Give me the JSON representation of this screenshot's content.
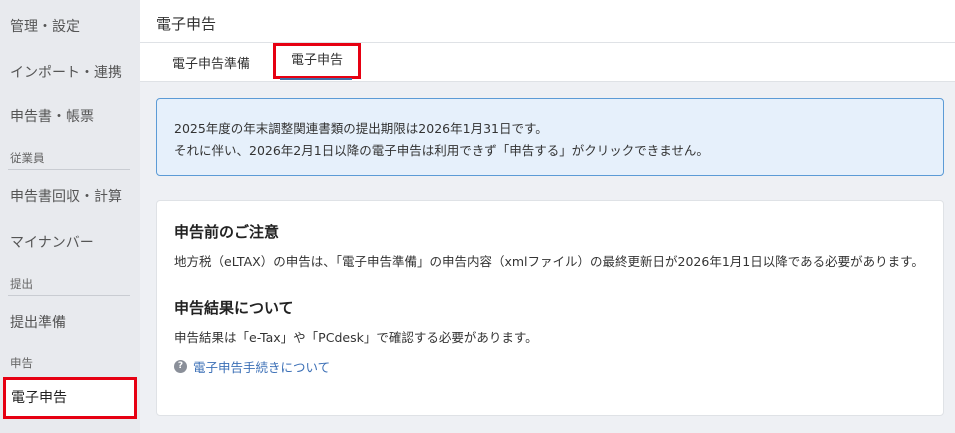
{
  "sidebar": {
    "items": [
      {
        "label": "管理・設定"
      },
      {
        "label": "インポート・連携"
      },
      {
        "label": "申告書・帳票"
      },
      {
        "label": "申告書回収・計算"
      },
      {
        "label": "マイナンバー"
      },
      {
        "label": "提出準備"
      },
      {
        "label": "電子申告"
      }
    ],
    "sections": [
      {
        "label": "従業員"
      },
      {
        "label": "提出"
      },
      {
        "label": "申告"
      }
    ]
  },
  "header": {
    "title": "電子申告"
  },
  "tabs": [
    {
      "label": "電子申告準備"
    },
    {
      "label": "電子申告"
    }
  ],
  "alert": {
    "line1": "2025年度の年末調整関連書類の提出期限は2026年1月31日です。",
    "line2": "それに伴い、2026年2月1日以降の電子申告は利用できず「申告する」がクリックできません。"
  },
  "card": {
    "heading1": "申告前のご注意",
    "text1": "地方税（eLTAX）の申告は、「電子申告準備」の申告内容（xmlファイル）の最終更新日が2026年1月1日以降である必要があります。",
    "heading2": "申告結果について",
    "text2": "申告結果は「e-Tax」や「PCdesk」で確認する必要があります。",
    "help_icon_glyph": "?",
    "help_link": "電子申告手続きについて"
  },
  "colors": {
    "highlight": "#e60012",
    "link": "#3b6fb6",
    "alert_border": "#5c9bd6",
    "alert_bg": "#e6f0fb"
  }
}
